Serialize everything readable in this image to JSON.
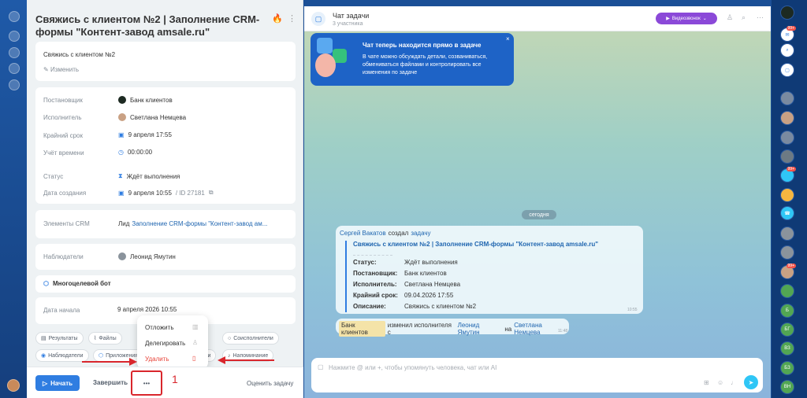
{
  "task": {
    "title": "Свяжись с клиентом №2 | Заполнение CRM-формы \"Контент-завод amsale.ru\"",
    "description": "Свяжись с клиентом №2",
    "edit_label": "Изменить",
    "fields": {
      "creator_label": "Постановщик",
      "creator_value": "Банк клиентов",
      "assignee_label": "Исполнитель",
      "assignee_value": "Светлана Немцева",
      "deadline_label": "Крайний срок",
      "deadline_value": "9 апреля 17:55",
      "time_label": "Учёт времени",
      "time_value": "00:00:00",
      "status_label": "Статус",
      "status_value": "Ждёт выполнения",
      "created_label": "Дата создания",
      "created_value": "9 апреля 10:55",
      "id_value": "/ ID 27181"
    },
    "crm_label": "Элементы CRM",
    "crm_prefix": "Лид",
    "crm_link": "Заполнение CRM-формы \"Контент-завод ам...",
    "observers_label": "Наблюдатели",
    "observers_value": "Леонид Ямутин",
    "bot_label": "Многоцелевой бот",
    "start_label": "Дата начала",
    "start_value": "9 апреля 2026 10:55",
    "chips": [
      "Результаты",
      "Файлы",
      "Соисполнители",
      "Наблюдатели",
      "Приложения",
      "…еги",
      "Напоминание"
    ],
    "menu": {
      "postpone": "Отложить",
      "delegate": "Делегировать",
      "delete": "Удалить"
    },
    "start_button": "Начать",
    "finish_button": "Завершить",
    "more_button": "•••",
    "rate_button": "Оценить задачу",
    "annotation": "1"
  },
  "chat": {
    "title": "Чат задачи",
    "subtitle": "3 участника",
    "video_button": "Видеозвонок",
    "promo_title": "Чат теперь находится прямо в задаче",
    "promo_text": "В чате можно обсуждать детали, созваниваться, обмениваться файлами и контролировать все изменения по задаче",
    "date_pill": "сегодня",
    "msg1": {
      "author": "Сергей Вакатов",
      "action": "создал",
      "object": "задачу",
      "task_title": "Свяжись с клиентом №2 | Заполнение CRM-формы \"Контент-завод amsale.ru\"",
      "rows": [
        {
          "k": "Статус:",
          "v": "Ждёт выполнения"
        },
        {
          "k": "Постановщик:",
          "v": "Банк клиентов"
        },
        {
          "k": "Исполнитель:",
          "v": "Светлана Немцева"
        },
        {
          "k": "Крайний срок:",
          "v": "09.04.2026 17:55"
        },
        {
          "k": "Описание:",
          "v": "Свяжись с клиентом №2"
        }
      ],
      "time": "10:55"
    },
    "msg2": {
      "author": "Банк клиентов",
      "text1": "изменил исполнителя с",
      "from": "Леонид Ямутин",
      "text2": "на",
      "to": "Светлана Немцева",
      "time": "11:48"
    },
    "input_placeholder": "Нажмите @ или +, чтобы упомянуть человека, чат или AI"
  },
  "rightbar": {
    "badges": [
      "99+",
      "99+",
      "99+"
    ],
    "initials": [
      "Б",
      "БГ",
      "ВЗ",
      "БЗ",
      "ВН",
      "АП"
    ]
  },
  "colors": {
    "accent": "#2fc6f6",
    "primary": "#2f7de1",
    "video": "#8b49d8",
    "danger": "#e8443a"
  }
}
